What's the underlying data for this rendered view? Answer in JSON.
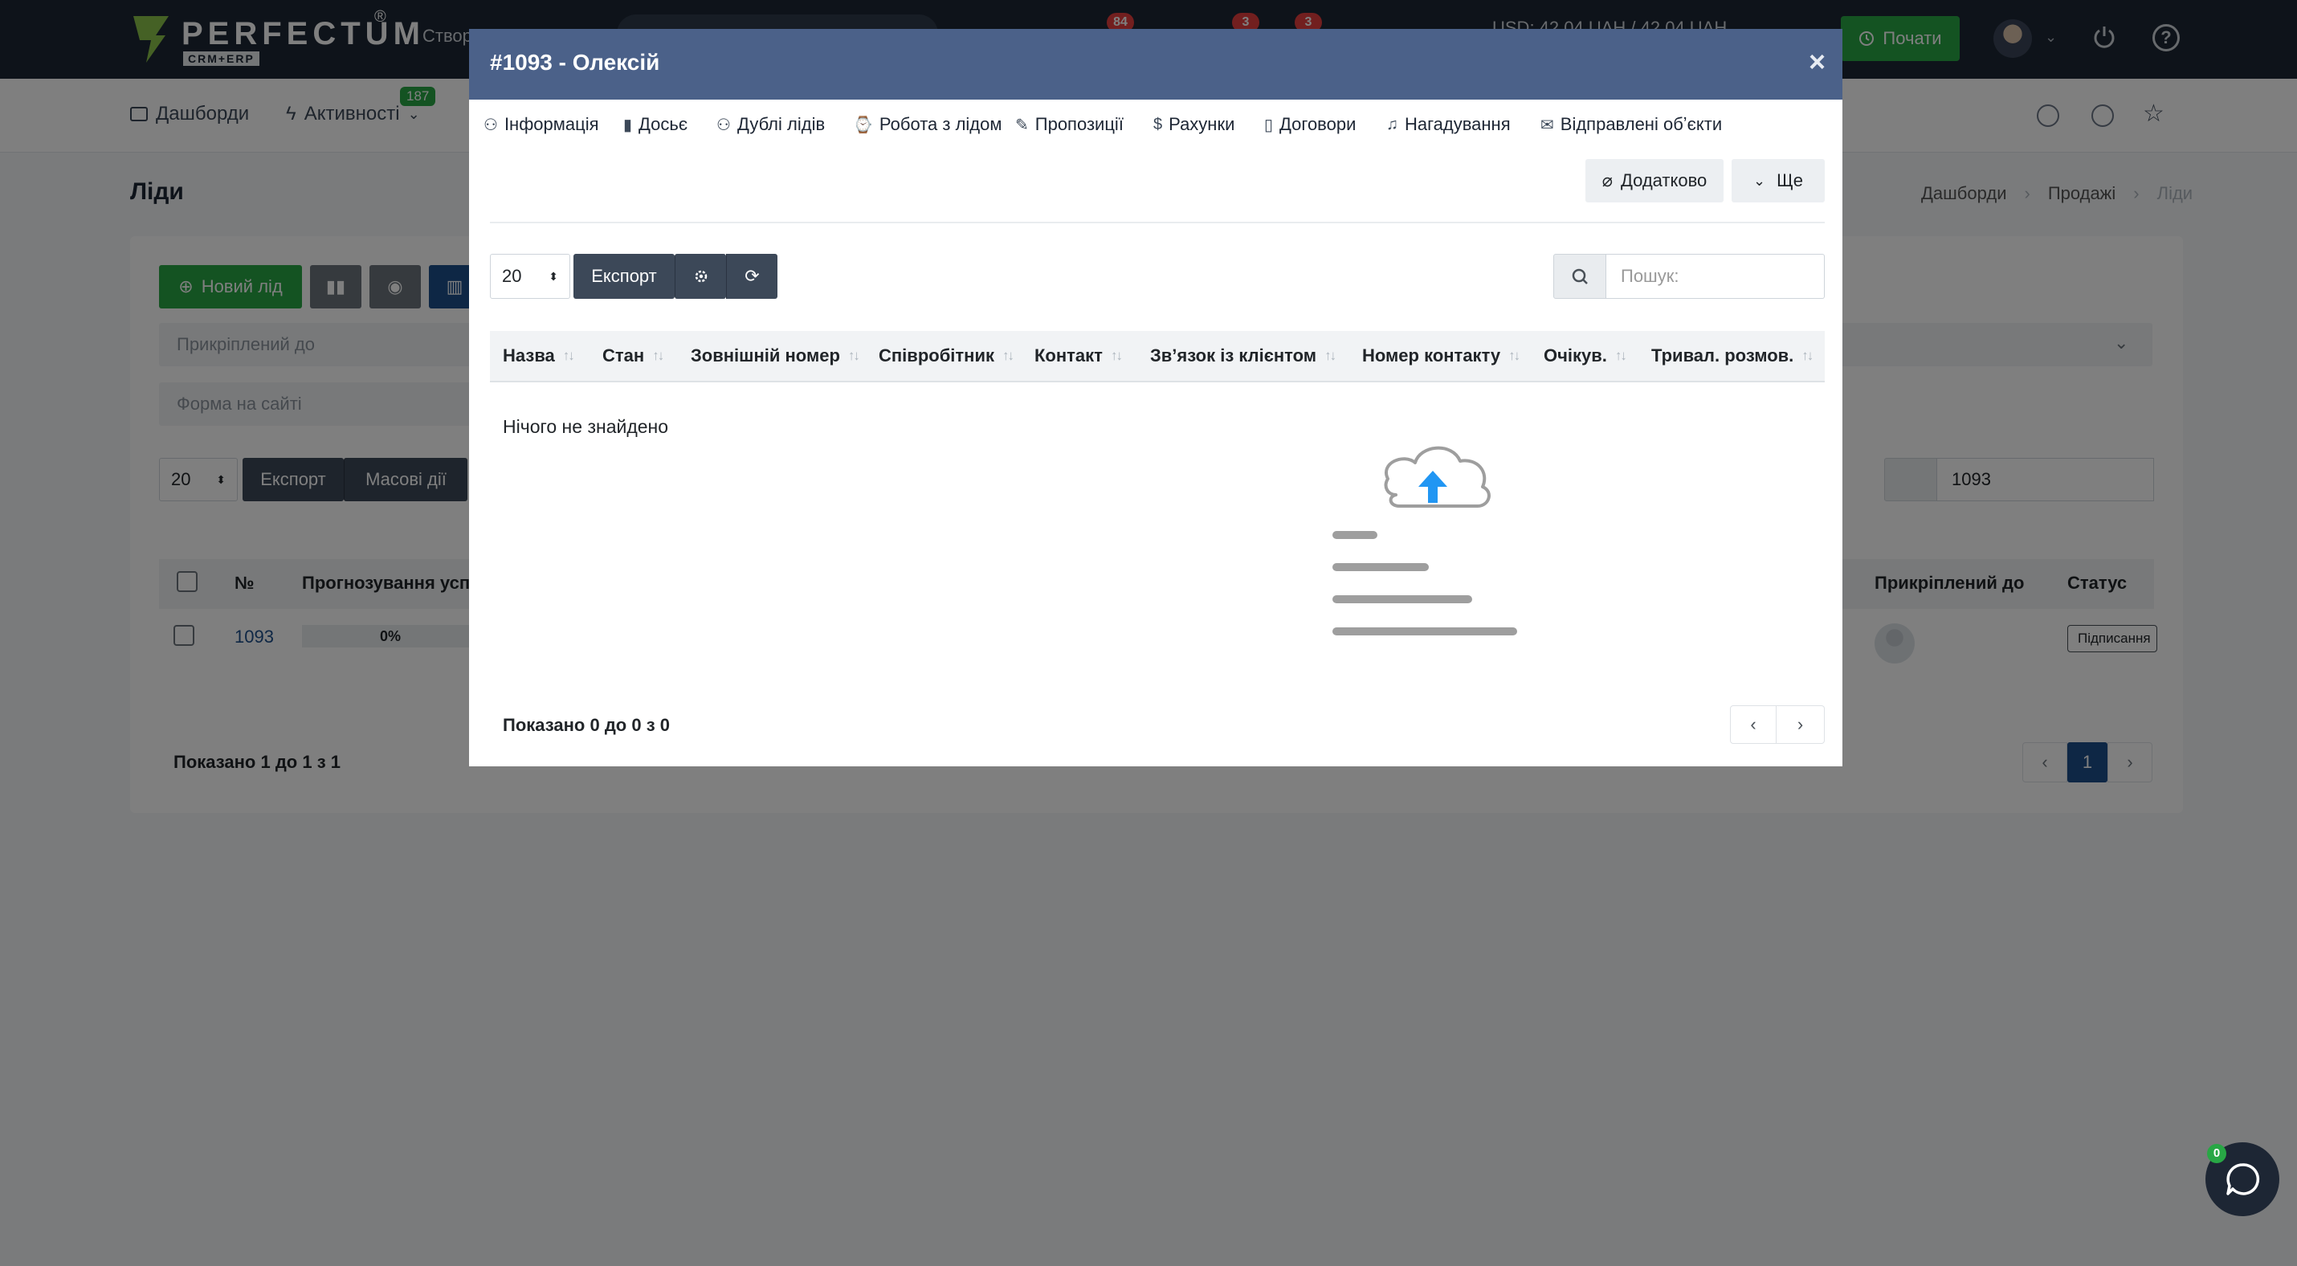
{
  "topbar": {
    "brand": "PERFECTUM",
    "brand_reg": "®",
    "brand_sub": "CRM+ERP",
    "create_label": "Створ",
    "badges": [
      "84",
      "3",
      "3"
    ],
    "currency": "USD: 42.04 UAH / 42.04 UAH",
    "start_label": "Почати"
  },
  "subnav": {
    "items": [
      "Дашборди",
      "Активності"
    ],
    "activity_badge": "187"
  },
  "page": {
    "title": "Ліди",
    "breadcrumb": [
      "Дашборди",
      "Продажі",
      "Ліди"
    ]
  },
  "background": {
    "new_lead": "Новий лід",
    "filter_attached": "Прикріплений до",
    "filter_form": "Форма на сайті",
    "page_size": "20",
    "export": "Експорт",
    "mass_actions": "Масові дії",
    "search_value": "1093",
    "columns": [
      "№",
      "Прогнозування успіх",
      "Прикріплений до",
      "Статус"
    ],
    "row": {
      "num": "1093",
      "progress": "0%",
      "status": "Підписання"
    },
    "shown": "Показано 1 до 1 з 1",
    "current_page": "1"
  },
  "modal": {
    "title": "#1093 - Олексій",
    "close": "×",
    "tabs": [
      {
        "icon": "user-icon",
        "label": "Інформація"
      },
      {
        "icon": "book-icon",
        "label": "Досьє"
      },
      {
        "icon": "users-icon",
        "label": "Дублі лідів"
      },
      {
        "icon": "watch-icon",
        "label": "Робота з лідом"
      },
      {
        "icon": "pencil-icon",
        "label": "Пропозиції"
      },
      {
        "icon": "dollar-icon",
        "label": "Рахунки"
      },
      {
        "icon": "file-icon",
        "label": "Договори"
      },
      {
        "icon": "bell-icon",
        "label": "Нагадування"
      },
      {
        "icon": "mail-icon",
        "label": "Відправлені обʼєкти"
      }
    ],
    "extra_label": "Додатково",
    "more_label": "Ще",
    "page_size": "20",
    "export": "Експорт",
    "search_placeholder": "Пошук:",
    "columns": [
      "Назва",
      "Стан",
      "Зовнішній номер",
      "Співробітник",
      "Контакт",
      "Звʼязок із клієнтом",
      "Номер контакту",
      "Очікув.",
      "Тривал. розмов."
    ],
    "empty_text": "Нічого не знайдено",
    "shown": "Показано 0 до 0 з 0"
  },
  "chat": {
    "badge": "0"
  },
  "colors": {
    "header": "#4b6189",
    "topbar": "#1d2634",
    "success": "#28a745",
    "accent": "#1d4e8a",
    "cloud_arrow": "#2196f3"
  }
}
